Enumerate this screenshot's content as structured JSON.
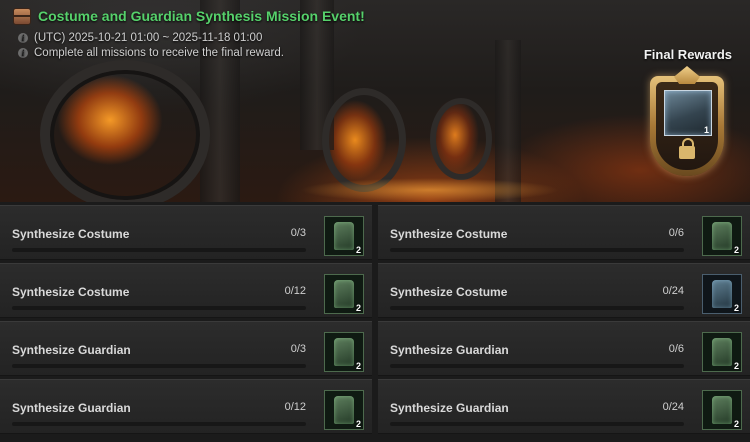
{
  "event": {
    "title": "Costume and Guardian Synthesis Mission Event!",
    "period": "(UTC) 2025-10-21 01:00 ~ 2025-11-18 01:00",
    "description": "Complete all missions to receive the final reward.",
    "icons": [
      "chest-icon",
      "info-icon"
    ]
  },
  "final_rewards": {
    "label": "Final Rewards",
    "count": "1",
    "locked": true
  },
  "colors": {
    "title_green": "#56d16b",
    "panel_bg": "#272727",
    "reward_gold": "#d9b66c"
  },
  "missions": [
    {
      "name": "Synthesize Costume",
      "progress": "0/3",
      "progress_fraction": 0,
      "reward_count": "2",
      "reward_tint": "green"
    },
    {
      "name": "Synthesize Costume",
      "progress": "0/6",
      "progress_fraction": 0,
      "reward_count": "2",
      "reward_tint": "green"
    },
    {
      "name": "Synthesize Costume",
      "progress": "0/12",
      "progress_fraction": 0,
      "reward_count": "2",
      "reward_tint": "green"
    },
    {
      "name": "Synthesize Costume",
      "progress": "0/24",
      "progress_fraction": 0,
      "reward_count": "2",
      "reward_tint": "blue"
    },
    {
      "name": "Synthesize Guardian",
      "progress": "0/3",
      "progress_fraction": 0,
      "reward_count": "2",
      "reward_tint": "green"
    },
    {
      "name": "Synthesize Guardian",
      "progress": "0/6",
      "progress_fraction": 0,
      "reward_count": "2",
      "reward_tint": "green"
    },
    {
      "name": "Synthesize Guardian",
      "progress": "0/12",
      "progress_fraction": 0,
      "reward_count": "2",
      "reward_tint": "green"
    },
    {
      "name": "Synthesize Guardian",
      "progress": "0/24",
      "progress_fraction": 0,
      "reward_count": "2",
      "reward_tint": "green"
    }
  ]
}
